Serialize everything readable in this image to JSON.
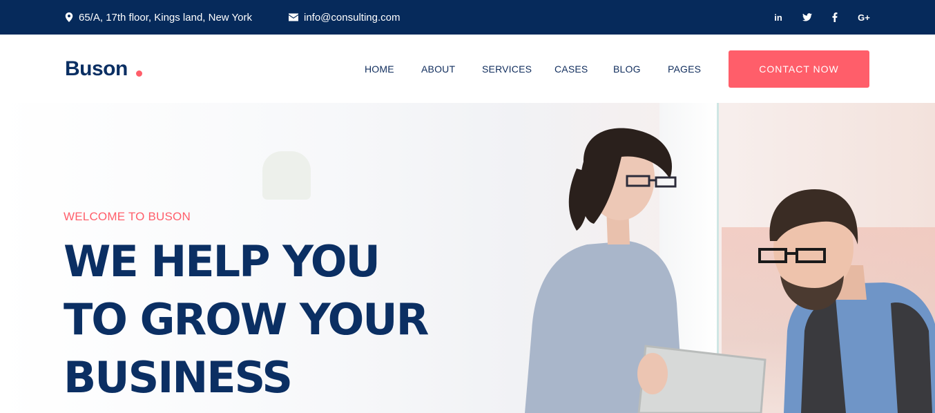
{
  "topbar": {
    "address": "65/A, 17th floor, Kings land, New York",
    "email": "info@consulting.com",
    "social": [
      {
        "icon": "linkedin-icon",
        "label": "in"
      },
      {
        "icon": "twitter-icon",
        "label": ""
      },
      {
        "icon": "facebook-icon",
        "label": ""
      },
      {
        "icon": "google-plus-icon",
        "label": "G+"
      }
    ]
  },
  "header": {
    "logo": "Buson",
    "nav": [
      "HOME",
      "ABOUT",
      "SERVICES",
      "CASES",
      "BLOG",
      "PAGES"
    ],
    "cta_label": "CONTACT NOW"
  },
  "hero": {
    "eyebrow": "WELCOME TO BUSON",
    "headline": [
      "WE HELP YOU",
      "TO GROW YOUR",
      "BUSINESS"
    ]
  },
  "colors": {
    "navy": "#062a5b",
    "heading": "#0b2f63",
    "accent": "#ff5e6a"
  }
}
